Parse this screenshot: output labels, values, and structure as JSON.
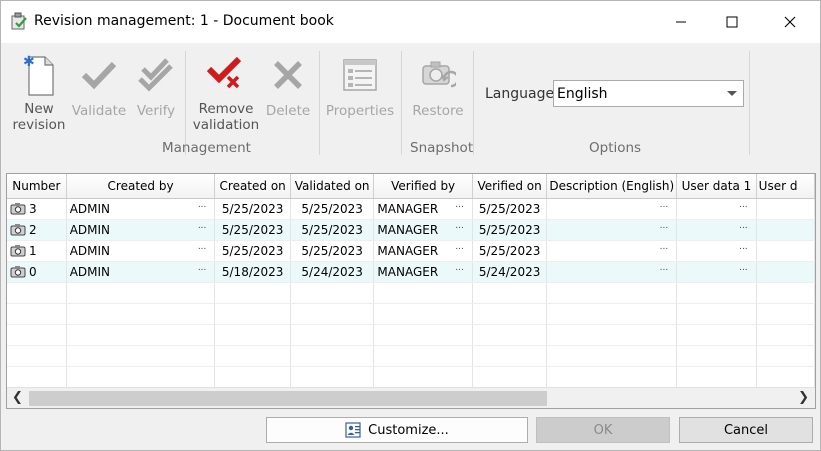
{
  "window": {
    "title": "Revision management: 1 - Document book",
    "minimize_icon": "minimize-icon",
    "maximize_icon": "maximize-icon",
    "close_icon": "close-icon"
  },
  "ribbon": {
    "management": {
      "group_label": "Management",
      "new_revision": {
        "line1": "New",
        "line2": "revision",
        "enabled": true,
        "icon": "new-document-icon"
      },
      "validate": {
        "label": "Validate",
        "enabled": false,
        "icon": "check-icon"
      },
      "verify": {
        "label": "Verify",
        "enabled": false,
        "icon": "double-check-icon"
      },
      "remove_validation": {
        "line1": "Remove",
        "line2": "validation",
        "enabled": true,
        "icon": "remove-check-icon"
      },
      "delete": {
        "label": "Delete",
        "enabled": false,
        "icon": "delete-x-icon"
      },
      "properties": {
        "label": "Properties",
        "enabled": false,
        "icon": "properties-list-icon"
      }
    },
    "snapshot": {
      "group_label": "Snapshot",
      "restore": {
        "label": "Restore",
        "enabled": false,
        "icon": "restore-camera-icon"
      }
    },
    "options": {
      "group_label": "Options",
      "language_label": "Language",
      "language_value": "English"
    }
  },
  "grid": {
    "columns": [
      "Number",
      "Created by",
      "Created on",
      "Validated on",
      "Verified by",
      "Verified on",
      "Description (English)",
      "User data 1",
      "User d"
    ],
    "rows": [
      {
        "number": "3",
        "created_by": "ADMIN",
        "created_on": "5/25/2023",
        "validated_on": "5/25/2023",
        "verified_by": "MANAGER",
        "verified_on": "5/25/2023"
      },
      {
        "number": "2",
        "created_by": "ADMIN",
        "created_on": "5/25/2023",
        "validated_on": "5/25/2023",
        "verified_by": "MANAGER",
        "verified_on": "5/25/2023"
      },
      {
        "number": "1",
        "created_by": "ADMIN",
        "created_on": "5/25/2023",
        "validated_on": "5/25/2023",
        "verified_by": "MANAGER",
        "verified_on": "5/25/2023"
      },
      {
        "number": "0",
        "created_by": "ADMIN",
        "created_on": "5/18/2023",
        "validated_on": "5/24/2023",
        "verified_by": "MANAGER",
        "verified_on": "5/24/2023"
      }
    ],
    "ellipsis": "..."
  },
  "footer": {
    "customize_label": "Customize...",
    "ok_label": "OK",
    "cancel_label": "Cancel"
  }
}
